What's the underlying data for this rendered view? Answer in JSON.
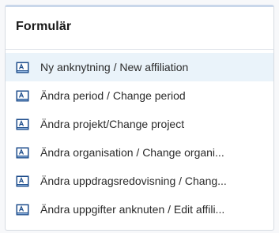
{
  "panel": {
    "title": "Formulär",
    "items": [
      {
        "label": "Ny anknytning / New affiliation",
        "icon": "form-document-icon",
        "highlighted": true
      },
      {
        "label": "Ändra period / Change period",
        "icon": "form-document-icon",
        "highlighted": false
      },
      {
        "label": "Ändra projekt/Change project",
        "icon": "form-document-icon",
        "highlighted": false
      },
      {
        "label": "Ändra organisation / Change organi...",
        "icon": "form-document-icon",
        "highlighted": false
      },
      {
        "label": "Ändra uppdragsredovisning / Chang...",
        "icon": "form-document-icon",
        "highlighted": false
      },
      {
        "label": "Ändra uppgifter anknuten / Edit affili...",
        "icon": "form-document-icon",
        "highlighted": false
      }
    ]
  },
  "colors": {
    "highlight_background": "#eaf3fa",
    "icon_blue": "#1f4e8c",
    "text": "#2b2b2b"
  }
}
